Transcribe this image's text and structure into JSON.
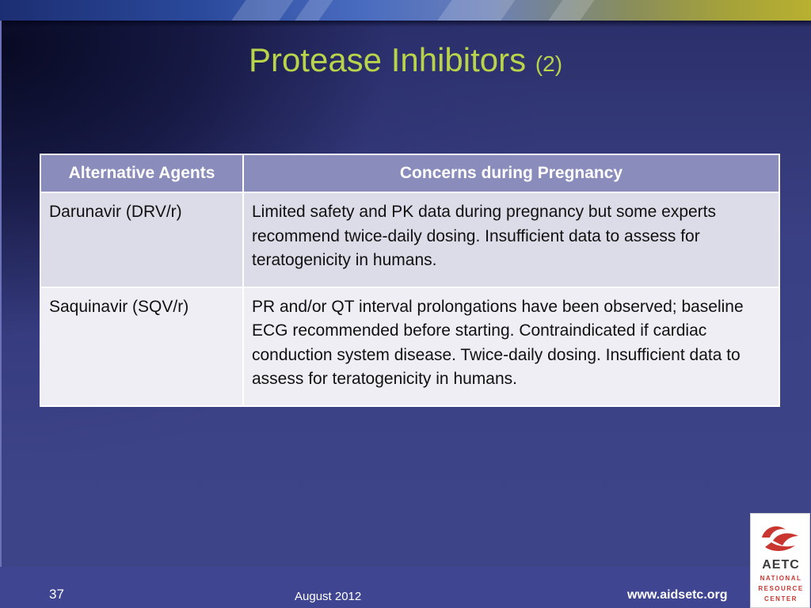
{
  "slide": {
    "title": "Protease Inhibitors",
    "title_suffix": "(2)",
    "page_number": "37",
    "date": "August 2012",
    "url": "www.aidsetc.org"
  },
  "table": {
    "headers": [
      "Alternative Agents",
      "Concerns during Pregnancy"
    ],
    "rows": [
      {
        "agent": "Darunavir (DRV/r)",
        "concern": "Limited safety and PK data during pregnancy but some experts recommend twice-daily dosing. Insufficient data to assess for teratogenicity in humans."
      },
      {
        "agent": "Saquinavir (SQV/r)",
        "concern": "PR and/or QT interval prolongations have been observed; baseline ECG recommended before starting. Contraindicated if cardiac conduction system disease. Twice-daily dosing. Insufficient data to assess for teratogenicity in humans."
      }
    ]
  },
  "logo": {
    "name": "AETC",
    "line1": "NATIONAL",
    "line2": "RESOURCE",
    "line3": "CENTER"
  },
  "colors": {
    "title": "#b9d44a",
    "header_bg": "#8a8cbc",
    "row_a_bg": "#dcdce8",
    "row_b_bg": "#eeeef4",
    "logo_red": "#c8362f"
  }
}
